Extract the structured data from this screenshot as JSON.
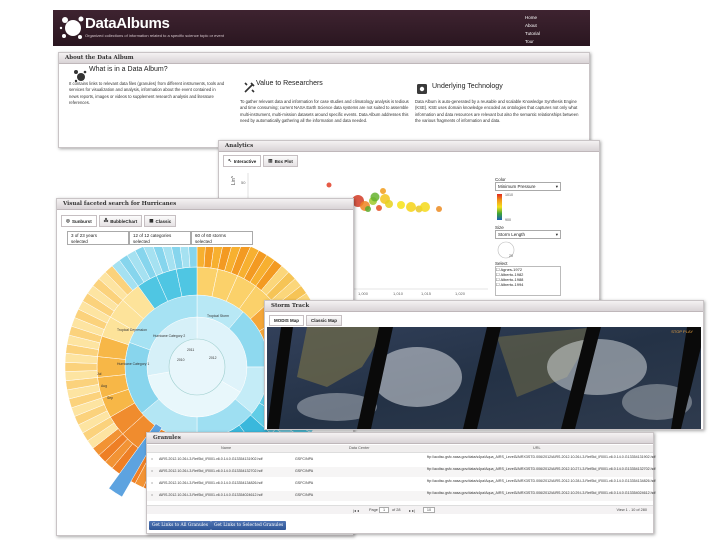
{
  "header": {
    "logo": "DataAlbums",
    "tagline": "Organized collections of information related to a specific science topic or event",
    "nav": [
      "Home",
      "About",
      "Tutorial",
      "Tour"
    ]
  },
  "about": {
    "title": "About the Data Album",
    "col1": {
      "heading": "What is in a Data Album?",
      "text": "It contains links to relevant data files (granules) from different instruments, tools and services for visualization and analysis, information about the event contained in news reports, images or videos to supplement research analysis and literature references."
    },
    "col2": {
      "heading": "Value to Researchers",
      "text": "To gather relevant data and information for case studies and climatology analysis is tedious and time consuming; current NASA Earth Science data systems are not suited to assemble multi-instrument, multi-mission datasets around specific events. Data Album addresses this need by automatically gathering all the information and data needed."
    },
    "col3": {
      "heading": "Underlying Technology",
      "text": "Data Album is auto-generated by a reusable and scalable Knowledge Synthesis Engine (KSE). KSE uses domain knowledge encoded as ontologies that captures not only what information and data resources are relevant but also the semantic relationships between the various fragments of information and data."
    }
  },
  "analytics": {
    "title": "Analytics",
    "tabs": [
      "Interactive",
      "Box Plot"
    ],
    "y_label": "Lin^",
    "y_tick": "50",
    "x_ticks": [
      "1,000",
      "1,010",
      "1,015",
      "1,020"
    ],
    "color_label": "Color",
    "color_select": "Minimum Pressure",
    "color_max": "1010",
    "color_min": "900",
    "size_label": "Size",
    "size_select": "Storm Length",
    "size_val": "20",
    "select_label": "Select",
    "storms": [
      "Agnes-1972",
      "Alberto-1982",
      "Alberto-1988",
      "Alberto-1994"
    ]
  },
  "facet": {
    "title": "Visual faceted search for Hurricanes",
    "tabs": [
      "Sunburst",
      "BubbleChart",
      "Classic"
    ],
    "selectors": [
      {
        "line1": "3 of 23 years",
        "line2": "selected"
      },
      {
        "line1": "12 of 12 categories",
        "line2": "selected"
      },
      {
        "line1": "60 of 60 storms",
        "line2": "selected"
      }
    ],
    "labels": [
      "Hurricane Category 1",
      "Hurricane Category 2",
      "Hurricane Category 3",
      "Tropical Storm",
      "Tropical Depression",
      "Extratropical",
      "Subtropical",
      "Jun",
      "Jul",
      "Aug",
      "Sep",
      "Oct",
      "Nov",
      "2010",
      "2011",
      "2012"
    ]
  },
  "storm": {
    "title": "Storm Track",
    "tabs": [
      "MODIS Map",
      "Classic Map"
    ],
    "play": "STOP PLAY"
  },
  "granules": {
    "title": "Granules",
    "headers": [
      "Name",
      "Data Center",
      "URL"
    ],
    "rows": [
      {
        "name": "AIRS.2012.10.26.L3.RetStd_IR001.v6.0.14.0.G13354131902.hdf",
        "center": "GSFC/NPA",
        "url": "ftp://acdisc.gsfc.nasa.gov/data/s4pa/Aqua_AIRS_Level3/AIRX3STD.006/2012/AIRS.2012.10.26.L3.RetStd_IR001.v6.0.14.0.G13354131902.hdf"
      },
      {
        "name": "AIRS.2012.10.26.L3.RetStd_IR001.v6.0.14.0.G13354132702.hdf",
        "center": "GSFC/NPA",
        "url": "ftp://acdisc.gsfc.nasa.gov/data/s4pa/Aqua_AIRS_Level3/AIRX3STD.006/2012/AIRS.2012.10.27.L3.RetStd_IR001.v6.0.14.0.G13354132702.hdf"
      },
      {
        "name": "AIRS.2012.10.26.L3.RetStd_IR001.v6.0.14.0.G13354134826.hdf",
        "center": "GSFC/NPA",
        "url": "ftp://acdisc.gsfc.nasa.gov/data/s4pa/Aqua_AIRS_Level3/AIRX3STD.006/2012/AIRS.2012.10.28.L3.RetStd_IR001.v6.0.14.0.G13354134826.hdf"
      },
      {
        "name": "AIRS.2012.10.26.L3.RetStd_IR001.v6.0.14.0.G13354024612.hdf",
        "center": "GSFC/NPA",
        "url": "ftp://acdisc.gsfc.nasa.gov/data/s4pa/Aqua_AIRS_Level3/AIRX3STD.006/2012/AIRS.2012.10.29.L3.RetStd_IR001.v6.0.14.0.G13354024612.hdf"
      }
    ],
    "pager": {
      "page_label": "Page",
      "page": "1",
      "of": "of 28",
      "per_page": "10",
      "view": "View 1 - 10 of 280"
    },
    "btn_all": "Get Links to All Granules",
    "btn_sel": "Get Links to Selected Granules"
  }
}
